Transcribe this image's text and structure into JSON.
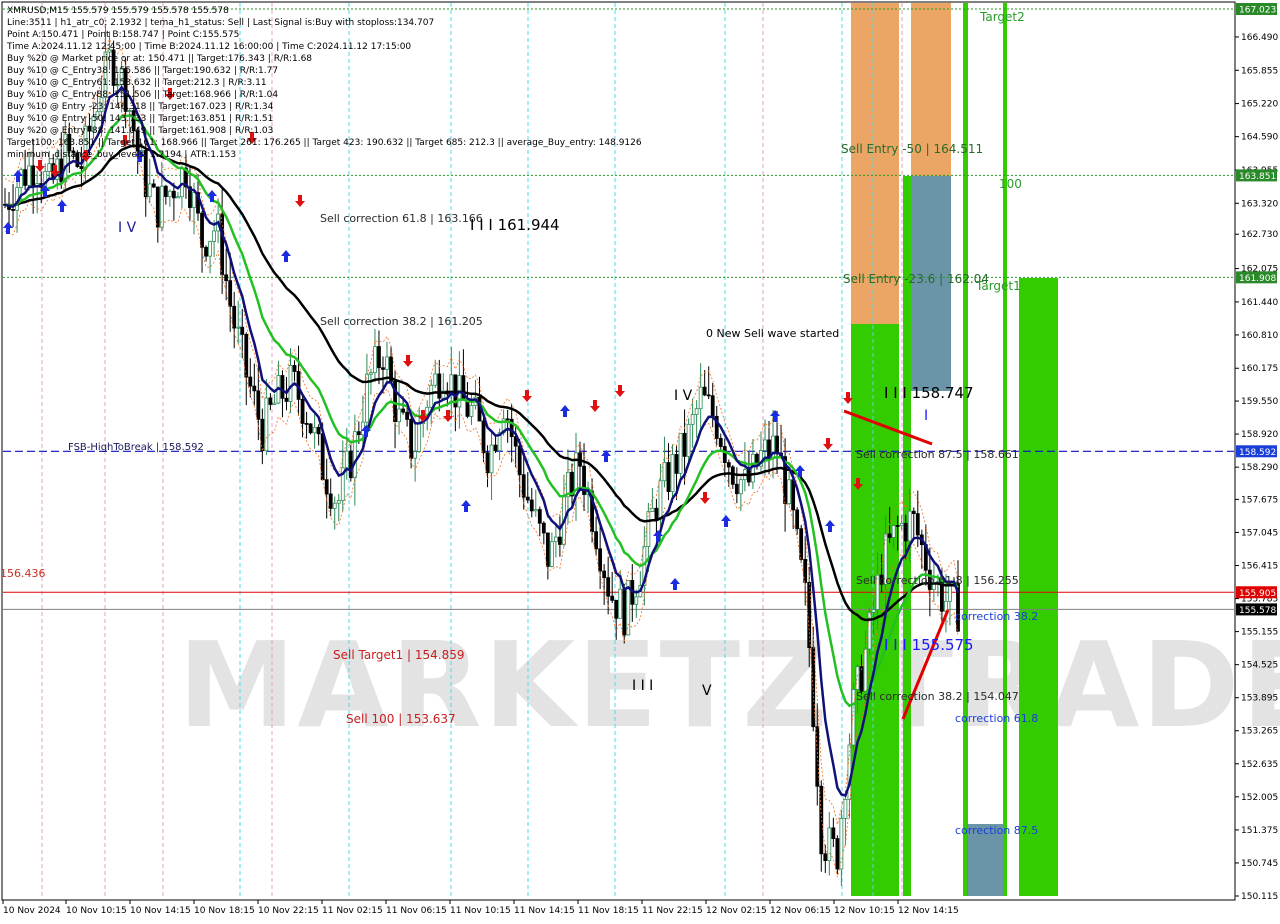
{
  "info": {
    "symbol_line": "XMRUSD,M15  155.579 155.579 155.578 155.578",
    "lines": [
      "Line:3511 | h1_atr_c0: 2.1932 | tema_h1_status: Sell | Last Signal is:Buy with stoploss:134.707",
      "Point A:150.471 | Point B:158.747 | Point C:155.575",
      "Time A:2024.11.12 12:45:00 | Time B:2024.11.12 16:00:00 | Time C:2024.11.12 17:15:00",
      "Buy %20 @ Market price or at: 150.471 || Target:176.343 | R/R:1.68",
      "Buy %10 @ C_Entry38: 155.586 || Target:190.632 | R/R:1.77",
      "Buy %10 @ C_Entry61: 153.632 || Target:212.3 | R/R:3.11",
      "Buy %10 @ C_Entry88: 151.506 || Target:168.966 | R/R:1.04",
      "Buy %10 @ Entry -23: 146.318 || Target:167.023 | R/R:1.34",
      "Buy %10 @ Entry -50: 143.733 || Target:163.851 | R/R:1.51",
      "Buy %20 @ Entry -88: 141.049 || Target:161.908 | R/R:1.03",
      "Target100: 163.851 || Target 161: 168.966 || Target 261: 176.265 || Target 423: 190.632 || Target 685: 212.3 || average_Buy_entry: 148.9126",
      "minimum_distance_buy_levels: 1.2194 | ATR:1.153"
    ]
  },
  "levels": {
    "fsb_label": "FSB-HighToBreak | 158.592",
    "left_price": "156.436",
    "buy_zone_price": "155.905",
    "current_price": "155.578"
  },
  "annotations": {
    "sell_correction_618": "Sell correction 61.8 | 163.166",
    "sell_correction_382_upper": "Sell correction 38.2 | 161.205",
    "wave_iii_upper": "I I I 161.944",
    "wave_iv_left": "I V",
    "wave_iv_mid": "I V",
    "new_sell_wave": "0 New Sell wave started",
    "wave_iii_158": "I I I 158.747",
    "wave_i": "I",
    "sell_correction_875": "Sell correction 87.5 | 158.661",
    "sell_correction_618_lower": "Sell correction 61.8 | 156.255",
    "wave_iii_155": "I I I 155.575",
    "sell_correction_382_lower": "Sell correction 38.2 | 154.047",
    "sell_target1": "Sell Target1 | 154.859",
    "sell_100": "Sell 100 | 153.637",
    "wave_iii_low": "I I I",
    "wave_v": "V",
    "sell_entry_50": "Sell Entry -50 | 164.511",
    "sell_entry_236": "Sell Entry -23.6 | 162.04",
    "target2": "Target2",
    "target1": "Target1",
    "label_100": "100",
    "correction_382": "correction 38.2",
    "correction_618": "correction 61.8",
    "correction_875": "correction 87.5"
  },
  "watermark": "MARKETZ TRADE",
  "colors": {
    "bull_candle": "#2e8b57",
    "ema_green": "#22c022",
    "ema_navy": "#10107a",
    "ema_black": "#000000",
    "zone_green": "#33cc00",
    "zone_orange": "#e8964a",
    "zone_steel": "#5a8aa0",
    "fsb_line": "#1010c0",
    "red_line": "#e00000",
    "target_green": "#2a9a2a",
    "price_tag_green": "#2a8a2a"
  },
  "chart_data": {
    "type": "candlestick",
    "symbol": "XMRUSD",
    "timeframe": "M15",
    "ylim": [
      150.115,
      167.023
    ],
    "y_ticks": [
      "166.490",
      "165.855",
      "165.220",
      "164.590",
      "163.955",
      "163.320",
      "162.730",
      "162.075",
      "161.440",
      "160.810",
      "160.175",
      "159.550",
      "158.920",
      "158.290",
      "157.675",
      "157.045",
      "156.415",
      "155.785",
      "155.155",
      "154.525",
      "153.895",
      "153.265",
      "152.635",
      "152.005",
      "151.375",
      "150.745",
      "150.115"
    ],
    "price_tags": [
      {
        "value": "167.023",
        "color": "#2a8a2a",
        "price": 167.023
      },
      {
        "value": "163.851",
        "color": "#2a8a2a",
        "price": 163.851
      },
      {
        "value": "161.908",
        "color": "#2a8a2a",
        "price": 161.908
      },
      {
        "value": "158.592",
        "color": "#1a3fd8",
        "price": 158.592
      },
      {
        "value": "155.905",
        "color": "#e00000",
        "price": 155.905
      },
      {
        "value": "155.578",
        "color": "#000000",
        "price": 155.578
      }
    ],
    "x_ticks": [
      "10 Nov 2024",
      "10 Nov 10:15",
      "10 Nov 14:15",
      "10 Nov 18:15",
      "10 Nov 22:15",
      "11 Nov 02:15",
      "11 Nov 06:15",
      "11 Nov 10:15",
      "11 Nov 14:15",
      "11 Nov 18:15",
      "11 Nov 22:15",
      "12 Nov 02:15",
      "12 Nov 06:15",
      "12 Nov 10:15",
      "12 Nov 14:15"
    ],
    "close_path": [
      163.3,
      163.8,
      164.1,
      163.6,
      164.3,
      164.0,
      165.2,
      166.1,
      165.5,
      164.0,
      163.2,
      163.6,
      164.0,
      162.6,
      162.9,
      161.2,
      160.0,
      159.0,
      159.6,
      159.9,
      159.3,
      158.3,
      157.6,
      158.6,
      159.9,
      160.5,
      159.2,
      158.6,
      159.7,
      160.2,
      159.6,
      159.3,
      158.5,
      159.6,
      158.2,
      157.3,
      156.5,
      157.6,
      158.4,
      157.2,
      155.9,
      155.5,
      156.4,
      157.6,
      158.2,
      158.7,
      159.6,
      159.2,
      158.3,
      157.9,
      158.5,
      158.7,
      157.4,
      155.6,
      151.2,
      150.9,
      153.6,
      154.9,
      156.5,
      157.1,
      157.3,
      156.4,
      155.8,
      155.6
    ]
  }
}
